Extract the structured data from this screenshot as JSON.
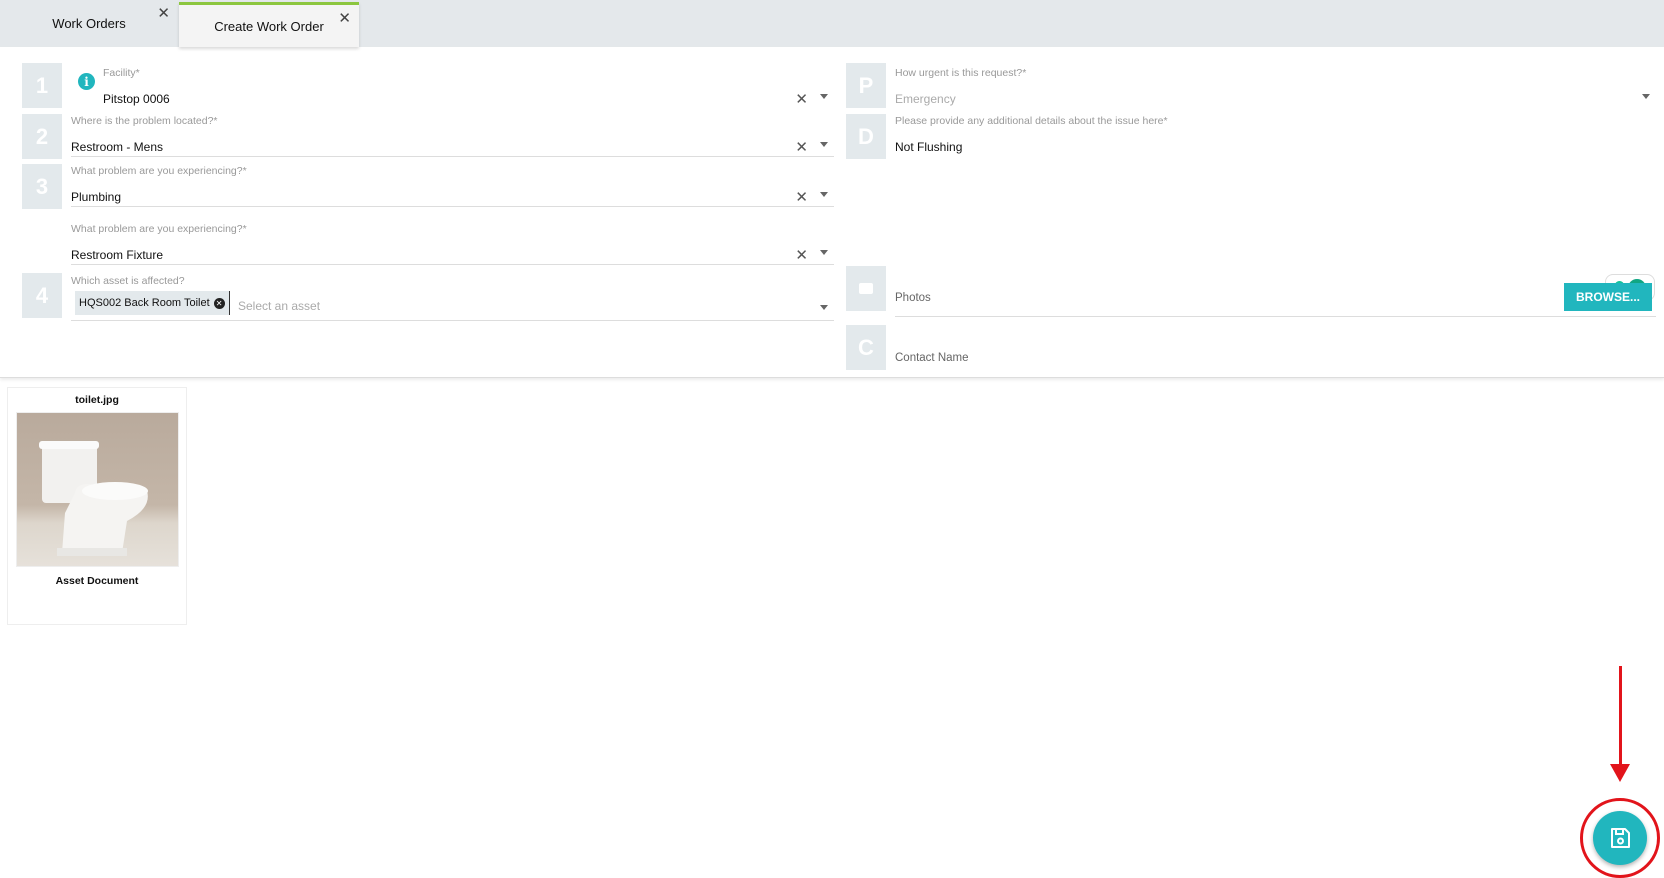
{
  "tabs": [
    {
      "label": "Work Orders",
      "close": "✕"
    },
    {
      "label": "Create Work Order",
      "close": "✕"
    }
  ],
  "left": {
    "facility": {
      "num": "1",
      "label": "Facility*",
      "value": "Pitstop 0006"
    },
    "location": {
      "num": "2",
      "label": "Where is the problem located?*",
      "value": "Restroom - Mens"
    },
    "problem": {
      "num": "3",
      "label": "What problem are you experiencing?*",
      "value": "Plumbing"
    },
    "subproblem": {
      "label": "What problem are you experiencing?*",
      "value": "Restroom Fixture"
    },
    "asset": {
      "num": "4",
      "label": "Which asset is affected?",
      "chip": "HQS002 Back Room Toilet",
      "placeholder": "Select an asset"
    }
  },
  "right": {
    "priority": {
      "num": "P",
      "label": "How urgent is this request?*",
      "value": "Emergency"
    },
    "details": {
      "num": "D",
      "label": "Please provide any additional details about the issue here*",
      "value": "Not Flushing"
    },
    "photos": {
      "label": "Photos",
      "button": "BROWSE..."
    },
    "contact": {
      "num": "C",
      "label": "Contact Name"
    }
  },
  "attachment": {
    "filename": "toilet.jpg",
    "caption": "Asset Document"
  },
  "colors": {
    "accent": "#21b6be",
    "annotation": "#e2141b",
    "tab_active": "#8cc63f"
  }
}
